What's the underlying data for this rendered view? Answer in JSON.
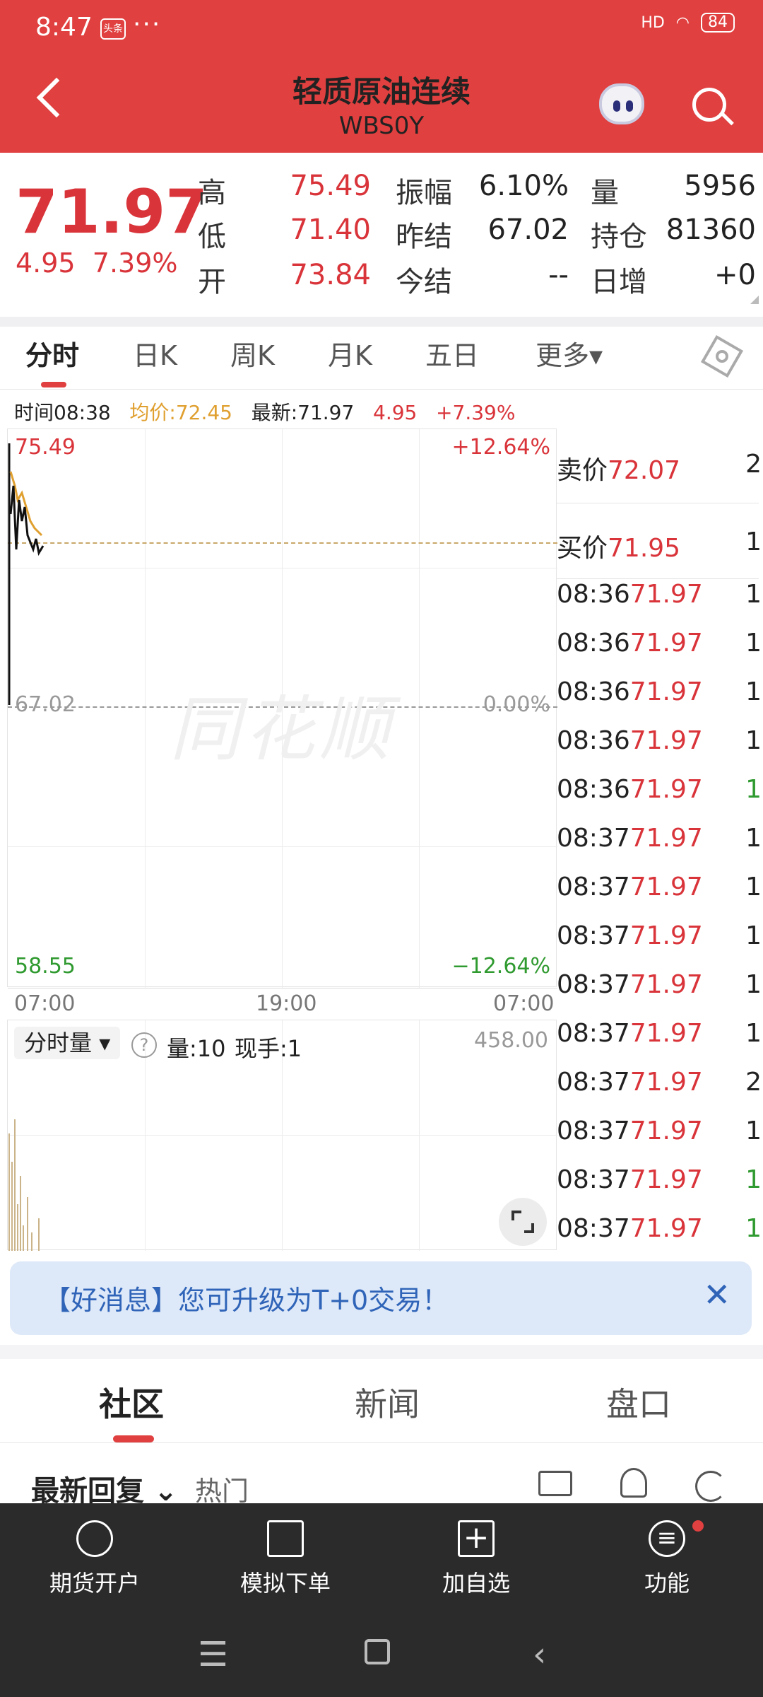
{
  "status_bar": {
    "time": "8:47",
    "app_badge": "头条",
    "dots": "···",
    "signal": "HD",
    "battery": "84"
  },
  "header": {
    "title": "轻质原油连续",
    "code": "WBS0Y"
  },
  "quote": {
    "price": "71.97",
    "change": "4.95",
    "change_pct": "7.39%",
    "fields": [
      {
        "label": "高",
        "value": "75.49",
        "color": "red"
      },
      {
        "label": "低",
        "value": "71.40",
        "color": "red"
      },
      {
        "label": "开",
        "value": "73.84",
        "color": "red"
      },
      {
        "label": "振幅",
        "value": "6.10%",
        "color": "dark"
      },
      {
        "label": "昨结",
        "value": "67.02",
        "color": "dark"
      },
      {
        "label": "今结",
        "value": "--",
        "color": "dark"
      },
      {
        "label": "量",
        "value": "5956",
        "color": "dark"
      },
      {
        "label": "持仓",
        "value": "81360",
        "color": "dark"
      },
      {
        "label": "日增",
        "value": "+0",
        "color": "dark"
      }
    ]
  },
  "tabs": [
    "分时",
    "日K",
    "周K",
    "月K",
    "五日",
    "更多▾"
  ],
  "info_line": {
    "time": "时间08:38",
    "avg": "均价:72.45",
    "latest": "最新:71.97",
    "chg": "4.95",
    "pct": "+7.39%"
  },
  "chart": {
    "high": "75.49",
    "mid": "67.02",
    "low": "58.55",
    "high_pct": "+12.64%",
    "mid_pct": "0.00%",
    "low_pct": "−12.64%",
    "x_labels": [
      "07:00",
      "19:00",
      "07:00"
    ],
    "watermark": "同花顺"
  },
  "volume": {
    "tag": "分时量",
    "help": "?",
    "vol": "量:10",
    "hand": "现手:1",
    "max": "458.00"
  },
  "orderbook": {
    "ask": {
      "label": "卖价",
      "price": "72.07",
      "qty": "2"
    },
    "bid": {
      "label": "买价",
      "price": "71.95",
      "qty": "1"
    },
    "ticks": [
      {
        "time": "08:36",
        "price": "71.97",
        "qty": "1",
        "color": "#222"
      },
      {
        "time": "08:36",
        "price": "71.97",
        "qty": "1",
        "color": "#222"
      },
      {
        "time": "08:36",
        "price": "71.97",
        "qty": "1",
        "color": "#222"
      },
      {
        "time": "08:36",
        "price": "71.97",
        "qty": "1",
        "color": "#222"
      },
      {
        "time": "08:36",
        "price": "71.97",
        "qty": "1",
        "color": "#2f9a2f"
      },
      {
        "time": "08:37",
        "price": "71.97",
        "qty": "1",
        "color": "#222"
      },
      {
        "time": "08:37",
        "price": "71.97",
        "qty": "1",
        "color": "#222"
      },
      {
        "time": "08:37",
        "price": "71.97",
        "qty": "1",
        "color": "#222"
      },
      {
        "time": "08:37",
        "price": "71.97",
        "qty": "1",
        "color": "#222"
      },
      {
        "time": "08:37",
        "price": "71.97",
        "qty": "1",
        "color": "#222"
      },
      {
        "time": "08:37",
        "price": "71.97",
        "qty": "2",
        "color": "#222"
      },
      {
        "time": "08:37",
        "price": "71.97",
        "qty": "1",
        "color": "#222"
      },
      {
        "time": "08:37",
        "price": "71.97",
        "qty": "1",
        "color": "#2f9a2f"
      },
      {
        "time": "08:37",
        "price": "71.97",
        "qty": "1",
        "color": "#2f9a2f"
      }
    ]
  },
  "banner": {
    "text": "【好消息】您可升级为T+0交易！"
  },
  "section_tabs": [
    "社区",
    "新闻",
    "盘口"
  ],
  "filters": {
    "latest": "最新回复",
    "hot": "热门"
  },
  "bottom_nav": [
    "期货开户",
    "模拟下单",
    "加自选",
    "功能"
  ],
  "colors": {
    "header": "#e0403f",
    "up": "#d9343a",
    "down": "#2f9a2f",
    "avg": "#e0a030"
  }
}
